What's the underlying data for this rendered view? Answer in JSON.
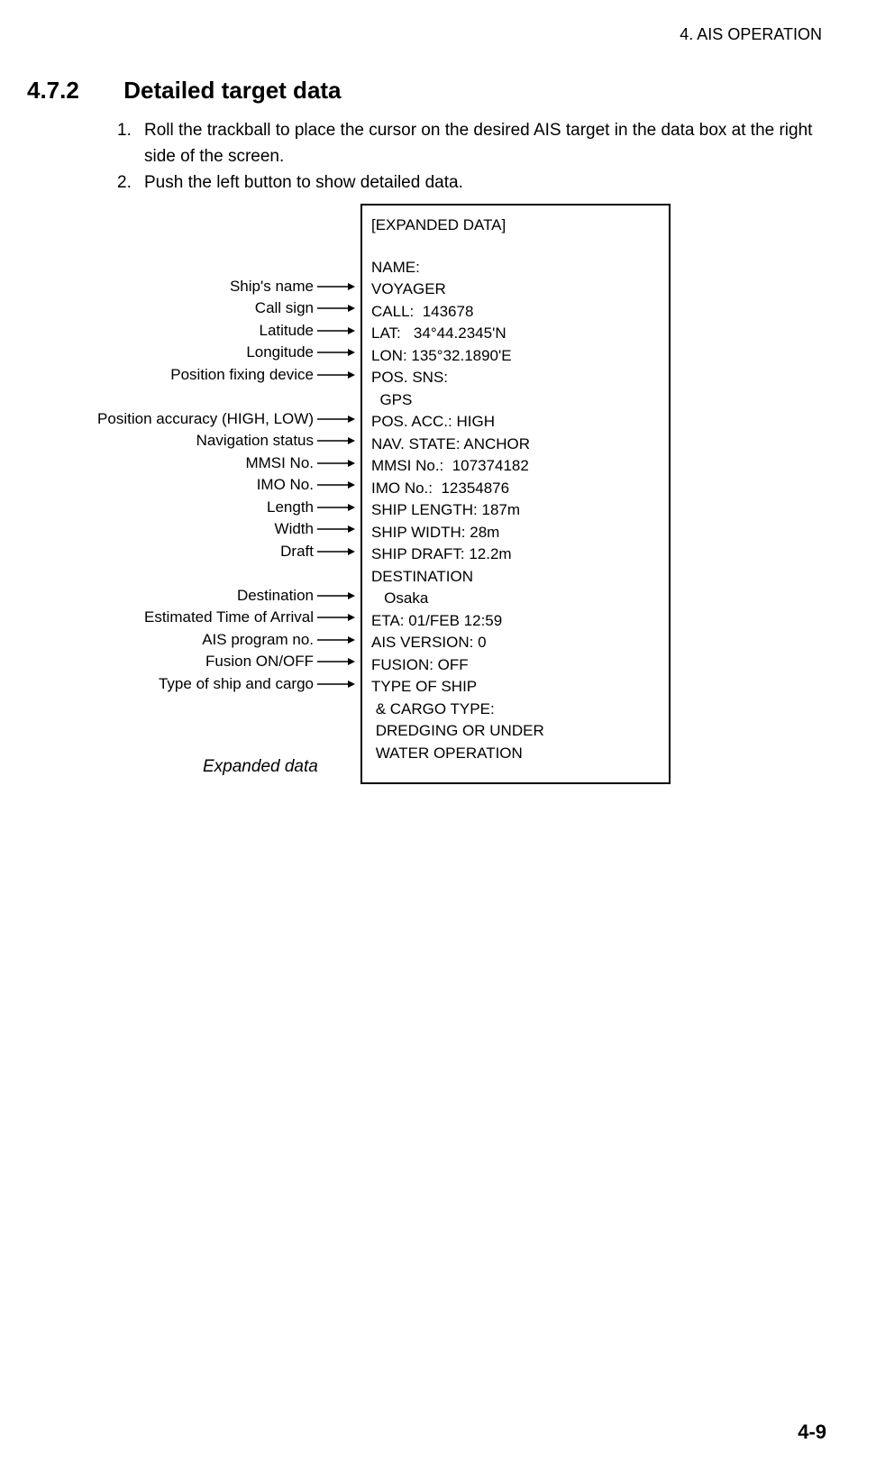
{
  "header": "4. AIS OPERATION",
  "section_number": "4.7.2",
  "section_title": "Detailed target data",
  "steps": [
    {
      "num": "1.",
      "text": "Roll the trackball to place the cursor on the desired AIS target in the data box at the right side of the screen."
    },
    {
      "num": "2.",
      "text": "Push the left button to show detailed data."
    }
  ],
  "box": {
    "title": "[EXPANDED DATA]",
    "lines": [
      "NAME:",
      "VOYAGER",
      "CALL:  143678",
      "LAT:   34°44.2345'N",
      "LON: 135°32.1890'E",
      "POS. SNS:",
      "  GPS",
      "POS. ACC.: HIGH",
      "NAV. STATE: ANCHOR",
      "MMSI No.:  107374182",
      "IMO No.:  12354876",
      "SHIP LENGTH: 187m",
      "SHIP WIDTH: 28m",
      "SHIP DRAFT: 12.2m",
      "DESTINATION",
      "   Osaka",
      "ETA: 01/FEB 12:59",
      "AIS VERSION: 0",
      "FUSION: OFF",
      "TYPE OF SHIP",
      " & CARGO TYPE:",
      " DREDGING OR UNDER",
      " WATER OPERATION"
    ]
  },
  "annotations": [
    {
      "label": "",
      "index": null
    },
    {
      "label": "Ship's name",
      "index": 1
    },
    {
      "label": "Call sign",
      "index": 2
    },
    {
      "label": "Latitude",
      "index": 3
    },
    {
      "label": "Longitude",
      "index": 4
    },
    {
      "label": "Position fixing device",
      "index": 5
    },
    {
      "label": "",
      "index": null
    },
    {
      "label": "Position accuracy (HIGH, LOW)",
      "index": 7
    },
    {
      "label": "Navigation status",
      "index": 8
    },
    {
      "label": "MMSI No.",
      "index": 9
    },
    {
      "label": "IMO No.",
      "index": 10
    },
    {
      "label": "Length",
      "index": 11
    },
    {
      "label": "Width",
      "index": 12
    },
    {
      "label": "Draft",
      "index": 13
    },
    {
      "label": "",
      "index": null
    },
    {
      "label": "Destination",
      "index": 15
    },
    {
      "label": "Estimated Time of Arrival",
      "index": 16
    },
    {
      "label": "AIS program no.",
      "index": 17
    },
    {
      "label": "Fusion ON/OFF",
      "index": 18
    },
    {
      "label": "Type of ship and cargo",
      "index": 19
    }
  ],
  "caption": "Expanded data",
  "footer": "4-9"
}
